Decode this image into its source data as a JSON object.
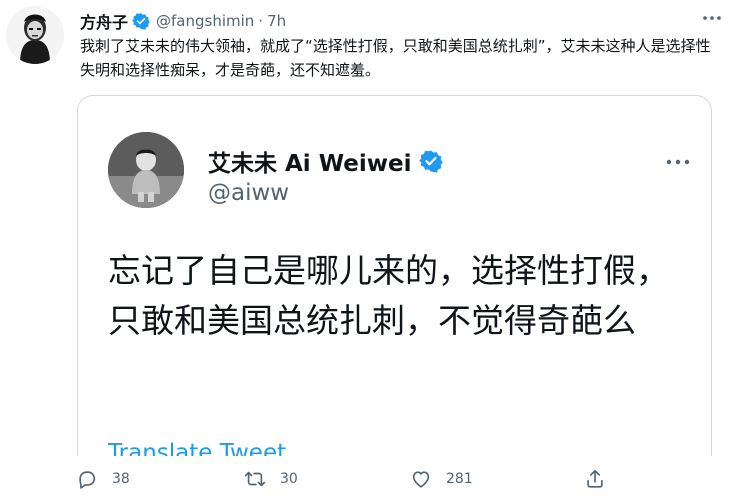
{
  "tweet": {
    "author_name": "方舟子",
    "author_handle": "@fangshimin",
    "time": "7h",
    "text": "我刺了艾未未的伟大领袖，就成了“选择性打假，只敢和美国总统扎刺”，艾未未这种人是选择性失明和选择性痴呆，才是奇葩，还不知遮羞。"
  },
  "quoted": {
    "author_name": "艾未未 Ai Weiwei",
    "author_handle": "@aiww",
    "text": "忘记了自己是哪儿来的，选择性打假，只敢和美国总统扎刺，不觉得奇葩么",
    "translate_label": "Translate Tweet"
  },
  "actions": {
    "reply_count": "38",
    "retweet_count": "30",
    "like_count": "281"
  },
  "icons": {
    "verified": "verified-badge-icon",
    "more": "more-icon",
    "reply": "reply-icon",
    "retweet": "retweet-icon",
    "like": "like-icon",
    "share": "share-icon"
  },
  "colors": {
    "accent": "#1d9bf0",
    "secondary_text": "#536471",
    "primary_text": "#0f1419",
    "border": "#cfd9de"
  }
}
